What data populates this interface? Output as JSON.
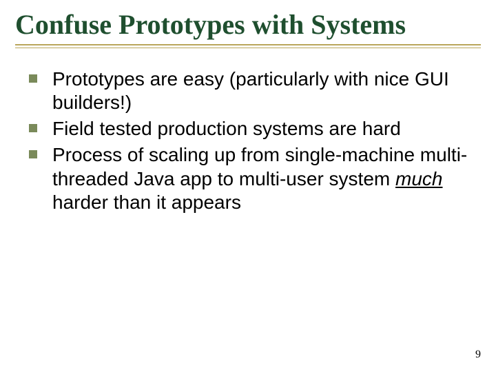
{
  "slide": {
    "title": "Confuse Prototypes with Systems",
    "bullets": [
      {
        "text_pre": "Prototypes are easy (particularly with nice GUI builders!)",
        "emph": "",
        "text_post": ""
      },
      {
        "text_pre": "Field tested production systems are hard",
        "emph": "",
        "text_post": ""
      },
      {
        "text_pre": "Process of scaling up from single-machine multi-threaded Java app to multi-user system ",
        "emph": "much",
        "text_post": " harder than it appears"
      }
    ],
    "page_number": "9"
  }
}
